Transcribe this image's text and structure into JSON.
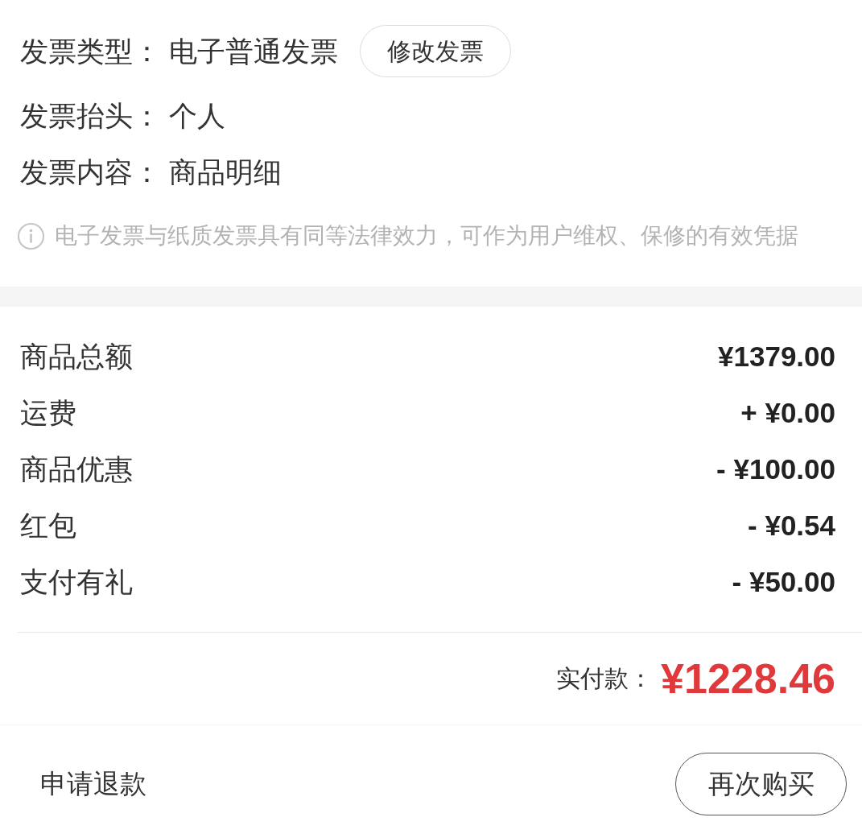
{
  "invoice": {
    "fields": [
      {
        "label": "发票类型：",
        "value": "电子普通发票",
        "button": "修改发票"
      },
      {
        "label": "发票抬头：",
        "value": "个人"
      },
      {
        "label": "发票内容：",
        "value": "商品明细"
      }
    ],
    "notice": "电子发票与纸质发票具有同等法律效力，可作为用户维权、保修的有效凭据"
  },
  "price_summary": {
    "rows": [
      {
        "label": "商品总额",
        "amount": "¥1379.00"
      },
      {
        "label": "运费",
        "amount": "+ ¥0.00"
      },
      {
        "label": "商品优惠",
        "amount": "- ¥100.00"
      },
      {
        "label": "红包",
        "amount": "- ¥0.54"
      },
      {
        "label": "支付有礼",
        "amount": "- ¥50.00"
      }
    ],
    "total": {
      "label": "实付款：",
      "amount": "¥1228.46"
    }
  },
  "actions": {
    "refund_link": "申请退款",
    "buy_again_button": "再次购买"
  }
}
